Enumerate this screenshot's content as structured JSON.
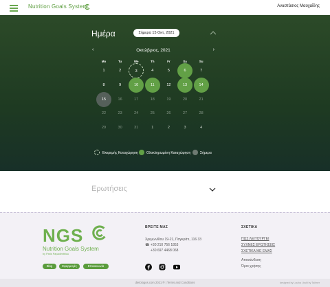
{
  "header": {
    "brand": "Nutrition Goals System",
    "user_name": "Αναστάσιος Μαοχαΐδης"
  },
  "calendar": {
    "title": "Ημέρα",
    "today_button": "Σήμερα 15 Οκτ, 2021",
    "month_label": "Οκτώβριος, 2021",
    "weekdays": [
      "Mo",
      "Tu",
      "We",
      "Th",
      "Fr",
      "Sa",
      "Su"
    ],
    "weeks": [
      [
        {
          "d": "1",
          "s": "normal"
        },
        {
          "d": "2",
          "s": "normal"
        },
        {
          "d": "3",
          "s": "pending"
        },
        {
          "d": "4",
          "s": "normal"
        },
        {
          "d": "5",
          "s": "normal"
        },
        {
          "d": "6",
          "s": "done"
        },
        {
          "d": "7",
          "s": "normal"
        }
      ],
      [
        {
          "d": "8",
          "s": "normal"
        },
        {
          "d": "9",
          "s": "normal"
        },
        {
          "d": "10",
          "s": "done"
        },
        {
          "d": "11",
          "s": "done"
        },
        {
          "d": "12",
          "s": "normal"
        },
        {
          "d": "13",
          "s": "done"
        },
        {
          "d": "14",
          "s": "done"
        }
      ],
      [
        {
          "d": "15",
          "s": "today"
        },
        {
          "d": "16",
          "s": "dim"
        },
        {
          "d": "17",
          "s": "dim"
        },
        {
          "d": "18",
          "s": "dim"
        },
        {
          "d": "19",
          "s": "dim"
        },
        {
          "d": "20",
          "s": "dim"
        },
        {
          "d": "21",
          "s": "dim"
        }
      ],
      [
        {
          "d": "22",
          "s": "dim"
        },
        {
          "d": "23",
          "s": "dim"
        },
        {
          "d": "24",
          "s": "dim"
        },
        {
          "d": "25",
          "s": "dim"
        },
        {
          "d": "26",
          "s": "dim"
        },
        {
          "d": "27",
          "s": "dim"
        },
        {
          "d": "28",
          "s": "dim"
        }
      ],
      [
        {
          "d": "29",
          "s": "dim"
        },
        {
          "d": "30",
          "s": "dim"
        },
        {
          "d": "31",
          "s": "dim"
        },
        {
          "d": "1",
          "s": "muted"
        },
        {
          "d": "2",
          "s": "muted"
        },
        {
          "d": "3",
          "s": "muted"
        },
        {
          "d": "4",
          "s": "muted"
        }
      ]
    ],
    "legend": {
      "pending": "Εκκρεμής Καταχώρηση",
      "done": "Ολοκληρωμένη Καταχώρηση",
      "today": "Σήμερα"
    }
  },
  "questions": {
    "title": "Ερωτήσεις"
  },
  "footer": {
    "brand_short": "NGS",
    "brand_full": "Nutrition Goals System",
    "brand_by": "by Paris Papadimitriou",
    "tags": [
      "Blog",
      "Εφαρμογές",
      "Επικοινωνία"
    ],
    "contact_heading": "ΒΡΕΙΤΕ ΜΑΣ",
    "address": "Χρεμωνίδου 19-21, Παγκράτι, 116 33",
    "phone1": "+30 210 756 1853",
    "phone2": "+30 697 4468 068",
    "about_heading": "ΣΧΕΤΙΚΑ",
    "links": [
      "ΠΩΣ ΛΕΙΤΟΥΡΓΕΙ",
      "ΣΥΧΝΕΣ ΕΡΩΤΗΣΕΙΣ",
      "ΣΧΕΤΙΚΑ ΜΕ ΕΜΑΣ"
    ],
    "privacy": "Αποσύνδεση",
    "terms": "Όροι χρήσης",
    "copyright": "dietologos.com 2021 ® | Terms and Conditions",
    "designed_by": "designed by Loufos | built by Tailmer"
  },
  "colors": {
    "accent": "#5a9c3c",
    "done": "#62a046",
    "hero_top": "#2c4a28",
    "hero_bottom": "#183028"
  }
}
